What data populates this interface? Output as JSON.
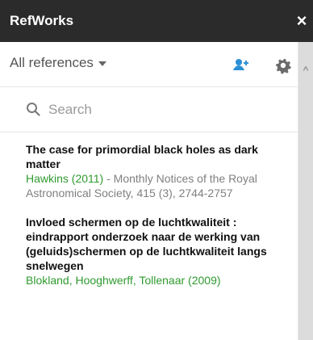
{
  "window": {
    "title": "RefWorks",
    "close_label": "×"
  },
  "toolbar": {
    "dropdown_label": "All references",
    "icons": {
      "add_user": "add-user-icon",
      "settings": "gear-icon",
      "dropdown_caret": "chevron-down-icon"
    },
    "accent_color": "#2b8fd6"
  },
  "search": {
    "placeholder": "Search",
    "value": ""
  },
  "references": [
    {
      "title": "The case for primordial black holes as dark matter",
      "authors": "Hawkins (2011)",
      "source": " - Monthly Notices of the Royal Astronomical Society, 415 (3), 2744-2757"
    },
    {
      "title": "Invloed schermen op de luchtkwaliteit : eindrapport onderzoek naar de werking van (geluids)schermen op de luchtkwaliteit langs snelwegen",
      "authors": "Blokland, Hooghwerff, Tollenaar (2009)",
      "source": ""
    }
  ]
}
